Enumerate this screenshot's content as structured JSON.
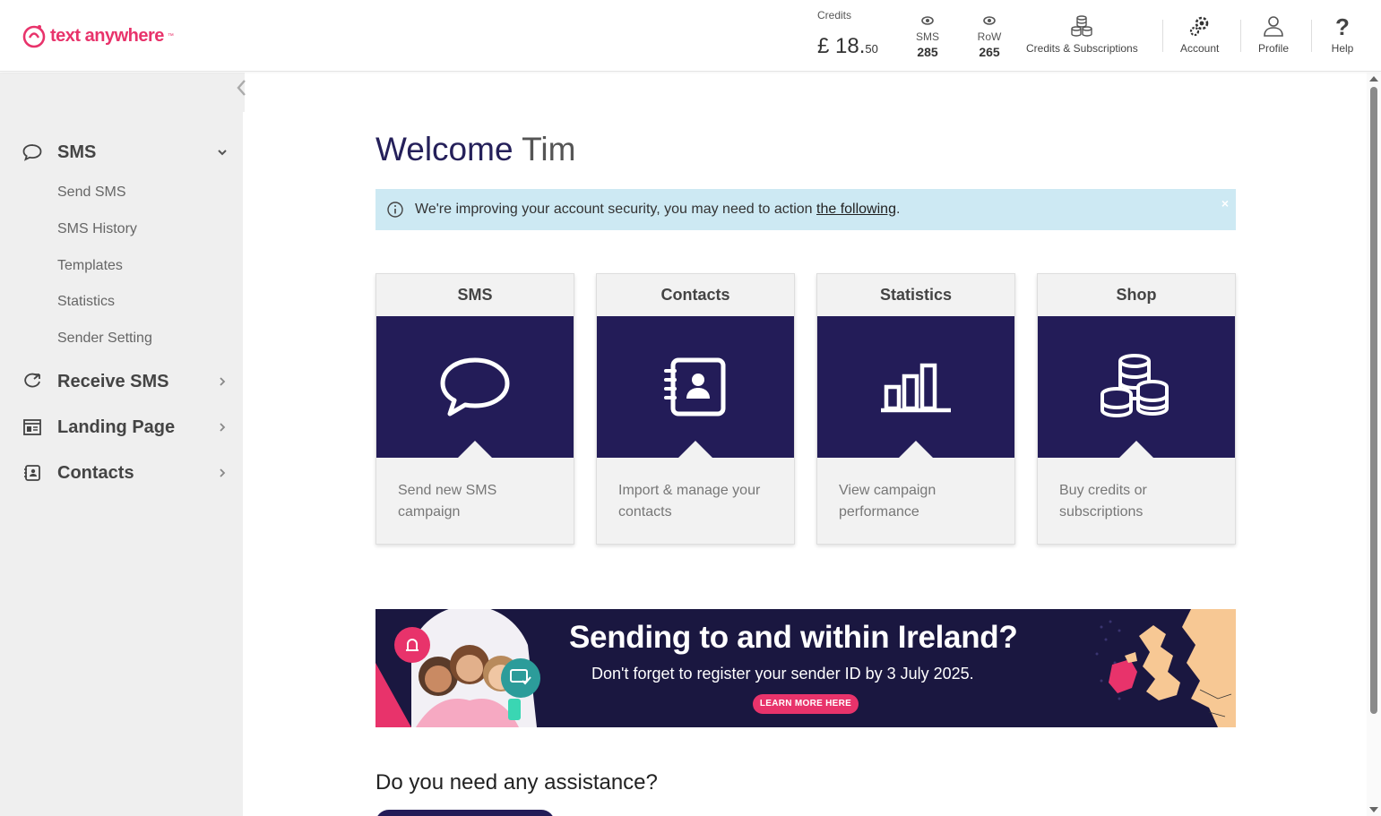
{
  "brand": {
    "name": "text anywhere",
    "tm": "™",
    "color": "#e8336b"
  },
  "header": {
    "credits_label": "Credits",
    "credits_currency": "£",
    "credits_pounds": "18.",
    "credits_pence": "50",
    "sms_label": "SMS",
    "sms_count": "285",
    "row_label": "RoW",
    "row_count": "265",
    "credits_subscriptions": "Credits & Subscriptions",
    "account": "Account",
    "profile": "Profile",
    "help": "Help"
  },
  "sidebar": {
    "sms": "SMS",
    "sms_items": [
      "Send SMS",
      "SMS History",
      "Templates",
      "Statistics",
      "Sender Setting"
    ],
    "receive_sms": "Receive SMS",
    "landing_page": "Landing Page",
    "contacts": "Contacts"
  },
  "main": {
    "welcome": "Welcome",
    "user_name": "Tim",
    "alert_text": "We're improving your account security, you may need to action",
    "alert_link": "the following",
    "alert_end": ".",
    "alert_close": "×",
    "cards": [
      {
        "title": "SMS",
        "desc": "Send new SMS campaign",
        "icon": "speech-bubble-icon"
      },
      {
        "title": "Contacts",
        "desc": "Import & manage your contacts",
        "icon": "address-book-icon"
      },
      {
        "title": "Statistics",
        "desc": "View campaign performance",
        "icon": "bar-chart-icon"
      },
      {
        "title": "Shop",
        "desc": "Buy credits or subscriptions",
        "icon": "coins-icon"
      }
    ],
    "banner": {
      "title": "Sending to and within Ireland?",
      "subtitle": "Don't forget to register your sender ID by 3 July 2025.",
      "button": "LEARN MORE HERE"
    },
    "assistance": "Do you need any assistance?"
  },
  "colors": {
    "navy": "#231c58",
    "pink": "#e8336b",
    "alert_bg": "#cde9f3",
    "sidebar_bg": "#efefef"
  }
}
